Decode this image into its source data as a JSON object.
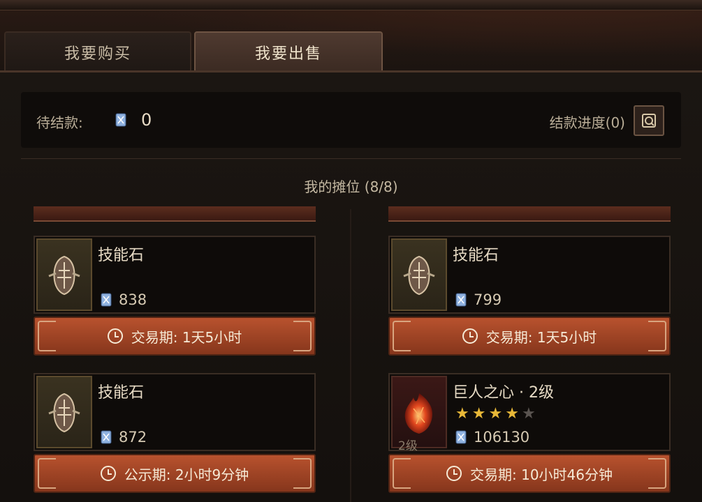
{
  "tabs": {
    "buy": "我要购买",
    "sell": "我要出售"
  },
  "pending": {
    "label": "待结款:",
    "amount": "0",
    "progress": "结款进度(0)"
  },
  "stall": {
    "title": "我的摊位 (8/8)"
  },
  "cards": [
    {
      "name": "技能石",
      "price": "838",
      "timer": "交易期: 1天5小时",
      "icon": "skill-stone-icon"
    },
    {
      "name": "技能石",
      "price": "799",
      "timer": "交易期: 1天5小时",
      "icon": "skill-stone-icon"
    },
    {
      "name": "技能石",
      "price": "872",
      "timer": "公示期: 2小时9分钟",
      "icon": "skill-stone-icon"
    },
    {
      "name": "巨人之心 · 2级",
      "price": "106130",
      "timer": "交易期: 10小时46分钟",
      "icon": "giant-heart-gem-icon",
      "level": "2级",
      "stars": {
        "filled": 4,
        "total": 5
      }
    }
  ],
  "colors": {
    "accent": "#b8522e",
    "star": "#e8b838",
    "currency": "#7fa6d8"
  }
}
